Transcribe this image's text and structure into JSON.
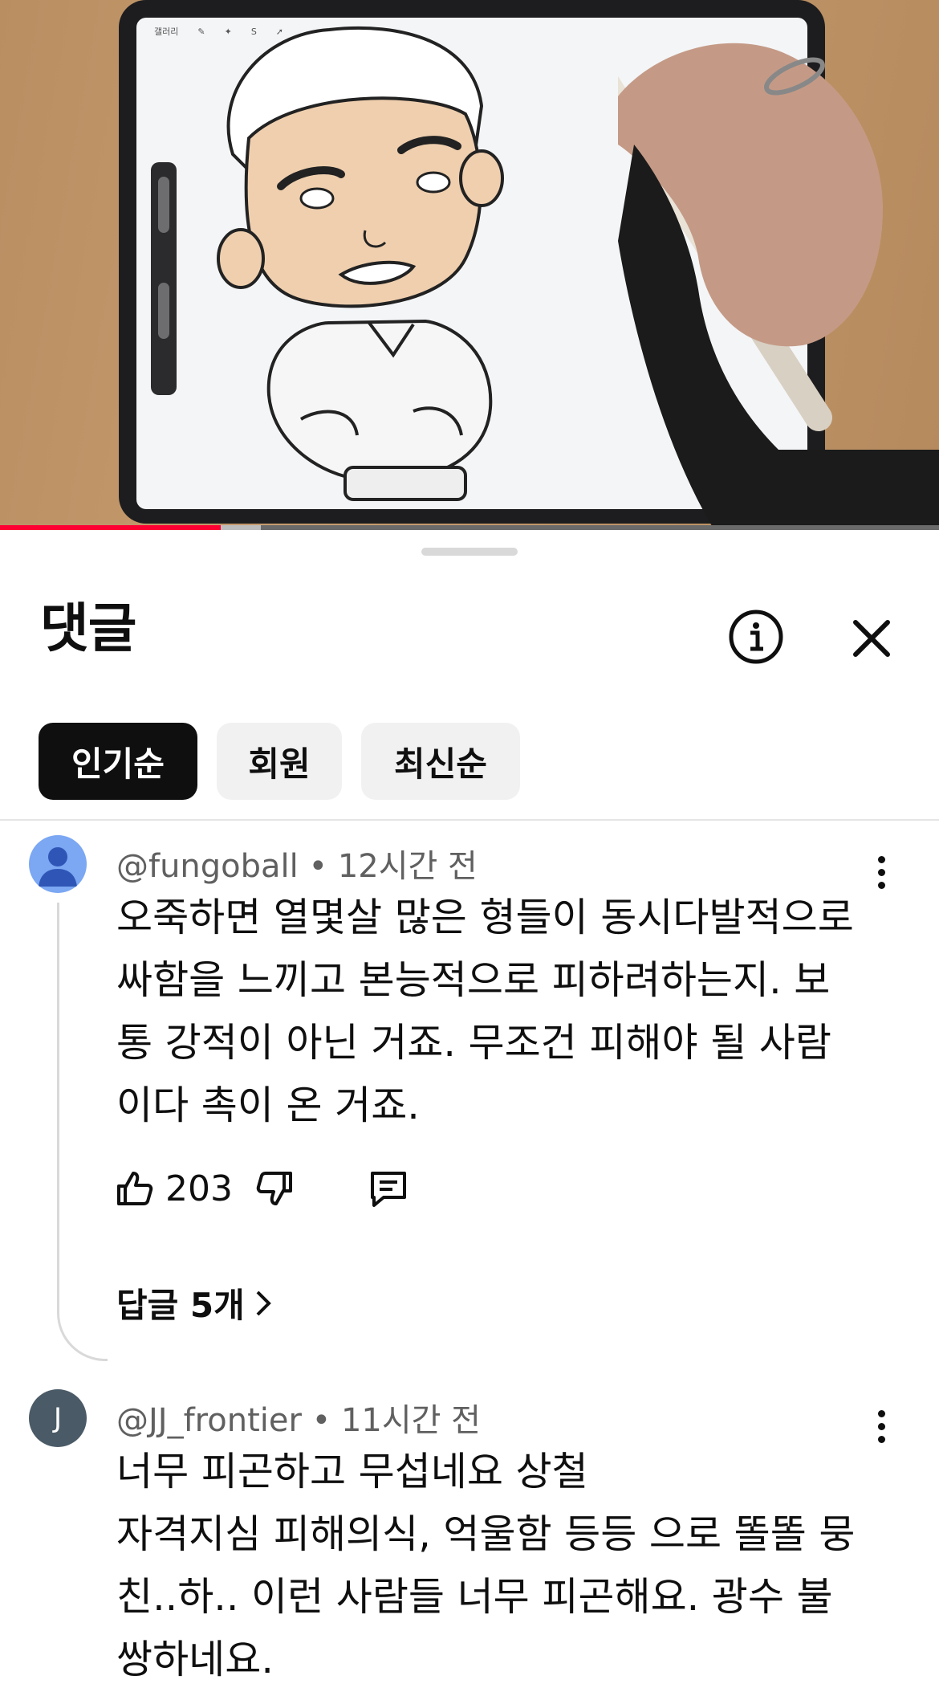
{
  "app": {
    "tablet_toolbar_label": "갤러리"
  },
  "progress": {
    "played_fraction": 0.235,
    "buffered_fraction": 0.278
  },
  "colors": {
    "accent": "#ff0033",
    "chip_active_bg": "#0f0f0f",
    "chip_bg": "#f1f1f1",
    "avatar_blue": "#7ba7f3",
    "avatar_slate": "#4a5a66"
  },
  "comments_panel": {
    "title": "댓글",
    "info_icon": "info-circle-icon",
    "close_icon": "close-icon",
    "filters": [
      {
        "label": "인기순",
        "active": true
      },
      {
        "label": "회원",
        "active": false
      },
      {
        "label": "최신순",
        "active": false
      }
    ]
  },
  "comments": [
    {
      "author": "@fungoball",
      "separator": "•",
      "time": "12시간 전",
      "text": "오죽하면 열몇살 많은 형들이 동시다발적으로\n싸함을 느끼고 본능적으로 피하려하는지. 보\n통 강적이 아닌 거죠. 무조건 피해야 될 사람\n이다 촉이 온 거죠.",
      "likes": "203",
      "replies_label": "답글 5개",
      "avatar_icon": "default-person-icon"
    },
    {
      "author": "@JJ_frontier",
      "separator": "•",
      "time": "11시간 전",
      "text": "너무 피곤하고 무섭네요 상철\n자격지심 피해의식, 억울함 등등 으로 똘똘 뭉\n친..하.. 이런 사람들 너무 피곤해요. 광수 불\n쌍하네요.",
      "avatar_letter": "J"
    }
  ]
}
